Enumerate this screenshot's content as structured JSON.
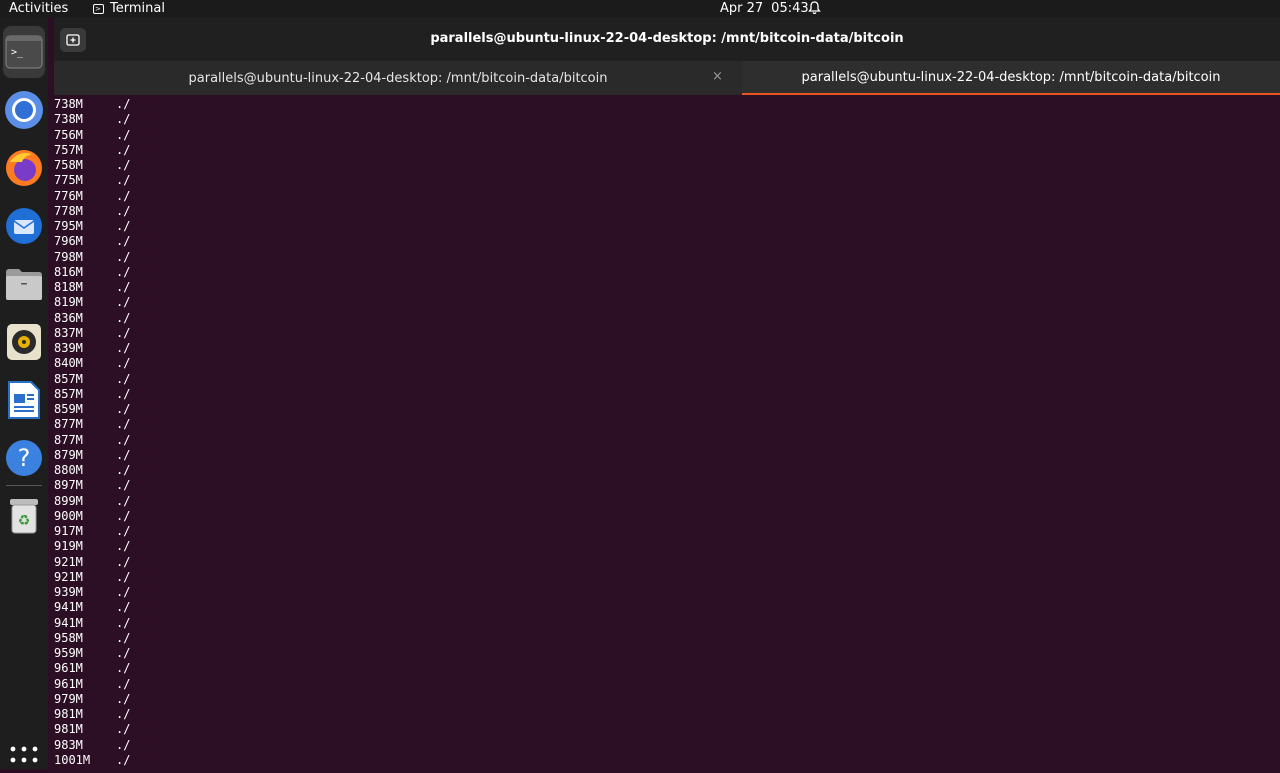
{
  "topbar": {
    "activities": "Activities",
    "app_name": "Terminal",
    "date": "Apr 27",
    "time": "05:43"
  },
  "dock": {
    "items": [
      {
        "name": "terminal"
      },
      {
        "name": "chromium"
      },
      {
        "name": "firefox"
      },
      {
        "name": "thunderbird"
      },
      {
        "name": "files"
      },
      {
        "name": "rhythmbox"
      },
      {
        "name": "libreoffice-writer"
      },
      {
        "name": "help"
      },
      {
        "name": "trash"
      },
      {
        "name": "show-applications"
      }
    ]
  },
  "window": {
    "title": "parallels@ubuntu-linux-22-04-desktop: /mnt/bitcoin-data/bitcoin",
    "tabs": [
      {
        "label": "parallels@ubuntu-linux-22-04-desktop: /mnt/bitcoin-data/bitcoin",
        "close": "×"
      },
      {
        "label": "parallels@ubuntu-linux-22-04-desktop: /mnt/bitcoin-data/bitcoin"
      }
    ]
  },
  "terminal": {
    "lines": [
      {
        "size": "738M",
        "path": "./"
      },
      {
        "size": "738M",
        "path": "./"
      },
      {
        "size": "756M",
        "path": "./"
      },
      {
        "size": "757M",
        "path": "./"
      },
      {
        "size": "758M",
        "path": "./"
      },
      {
        "size": "775M",
        "path": "./"
      },
      {
        "size": "776M",
        "path": "./"
      },
      {
        "size": "778M",
        "path": "./"
      },
      {
        "size": "795M",
        "path": "./"
      },
      {
        "size": "796M",
        "path": "./"
      },
      {
        "size": "798M",
        "path": "./"
      },
      {
        "size": "816M",
        "path": "./"
      },
      {
        "size": "818M",
        "path": "./"
      },
      {
        "size": "819M",
        "path": "./"
      },
      {
        "size": "836M",
        "path": "./"
      },
      {
        "size": "837M",
        "path": "./"
      },
      {
        "size": "839M",
        "path": "./"
      },
      {
        "size": "840M",
        "path": "./"
      },
      {
        "size": "857M",
        "path": "./"
      },
      {
        "size": "857M",
        "path": "./"
      },
      {
        "size": "859M",
        "path": "./"
      },
      {
        "size": "877M",
        "path": "./"
      },
      {
        "size": "877M",
        "path": "./"
      },
      {
        "size": "879M",
        "path": "./"
      },
      {
        "size": "880M",
        "path": "./"
      },
      {
        "size": "897M",
        "path": "./"
      },
      {
        "size": "899M",
        "path": "./"
      },
      {
        "size": "900M",
        "path": "./"
      },
      {
        "size": "917M",
        "path": "./"
      },
      {
        "size": "919M",
        "path": "./"
      },
      {
        "size": "921M",
        "path": "./"
      },
      {
        "size": "921M",
        "path": "./"
      },
      {
        "size": "939M",
        "path": "./"
      },
      {
        "size": "941M",
        "path": "./"
      },
      {
        "size": "941M",
        "path": "./"
      },
      {
        "size": "958M",
        "path": "./"
      },
      {
        "size": "959M",
        "path": "./"
      },
      {
        "size": "961M",
        "path": "./"
      },
      {
        "size": "961M",
        "path": "./"
      },
      {
        "size": "979M",
        "path": "./"
      },
      {
        "size": "981M",
        "path": "./"
      },
      {
        "size": "981M",
        "path": "./"
      },
      {
        "size": "983M",
        "path": "./"
      },
      {
        "size": "1001M",
        "path": "./"
      }
    ]
  }
}
